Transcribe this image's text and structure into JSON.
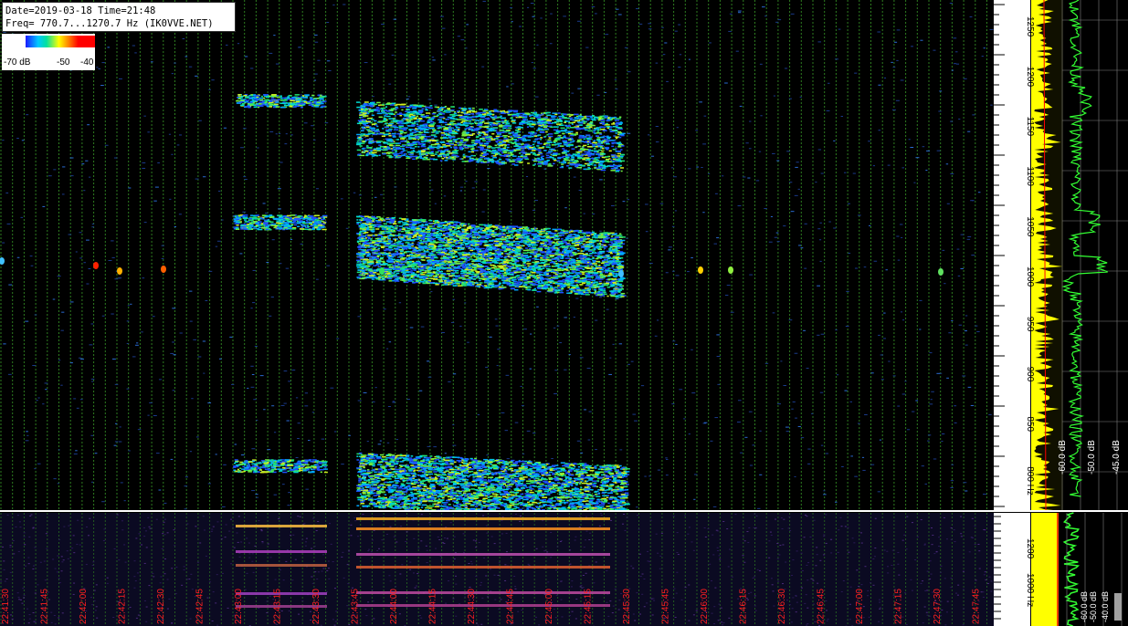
{
  "header": {
    "date_line": "Date=2019-03-18 Time=21:48",
    "freq_line": "Freq= 770.7...1270.7 Hz (IK0VVE.NET)"
  },
  "scale": {
    "low_label": "-70 dB",
    "mid_label": "-50",
    "high_label": "-40"
  },
  "freq_axis": {
    "main_labels": [
      "1250",
      "1200",
      "1150",
      "1100",
      "1050",
      "1000",
      "950",
      "900",
      "850",
      "800 Hz"
    ],
    "lower_labels": [
      "1200",
      "1000 Hz"
    ]
  },
  "db_axis": {
    "main_labels": [
      "-60.0 dB",
      "-50.0 dB",
      "-45.0 dB"
    ],
    "lower_labels": [
      "-60.0 dB",
      "-50.0 dB",
      "-40.0 dB"
    ]
  },
  "time_axis": {
    "labels": [
      "22:41:30",
      "22:41:45",
      "22:42:00",
      "22:42:15",
      "22:42:30",
      "22:42:45",
      "22:43:00",
      "22:43:15",
      "22:43:30",
      "22:43:45",
      "22:44:00",
      "22:44:15",
      "22:44:30",
      "22:44:45",
      "22:45:00",
      "22:45:15",
      "22:45:30",
      "22:45:45",
      "22:46:00",
      "22:46:15",
      "22:46:30",
      "22:46:45",
      "22:47:00",
      "22:47:15",
      "22:47:30",
      "22:47:45"
    ]
  },
  "colors": {
    "background": "#000000",
    "grid_line": "#2e7d20",
    "time_label": "#ff2020",
    "spectrum_yellow": "#ffff00",
    "spectrum_green": "#33ff33",
    "lower_bg": "#0b0a22"
  }
}
